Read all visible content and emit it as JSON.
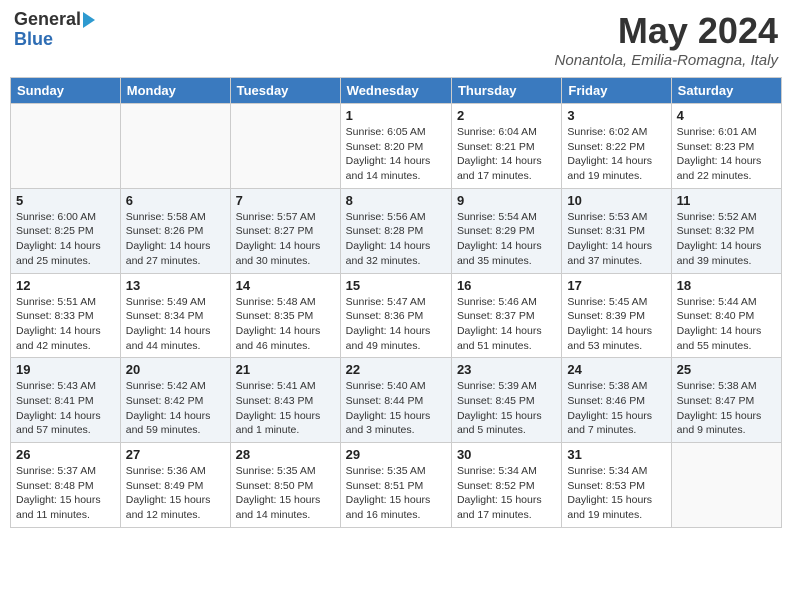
{
  "logo": {
    "general": "General",
    "blue": "Blue"
  },
  "title": {
    "month_year": "May 2024",
    "location": "Nonantola, Emilia-Romagna, Italy"
  },
  "calendar": {
    "headers": [
      "Sunday",
      "Monday",
      "Tuesday",
      "Wednesday",
      "Thursday",
      "Friday",
      "Saturday"
    ],
    "weeks": [
      [
        {
          "day": "",
          "info": ""
        },
        {
          "day": "",
          "info": ""
        },
        {
          "day": "",
          "info": ""
        },
        {
          "day": "1",
          "info": "Sunrise: 6:05 AM\nSunset: 8:20 PM\nDaylight: 14 hours and 14 minutes."
        },
        {
          "day": "2",
          "info": "Sunrise: 6:04 AM\nSunset: 8:21 PM\nDaylight: 14 hours and 17 minutes."
        },
        {
          "day": "3",
          "info": "Sunrise: 6:02 AM\nSunset: 8:22 PM\nDaylight: 14 hours and 19 minutes."
        },
        {
          "day": "4",
          "info": "Sunrise: 6:01 AM\nSunset: 8:23 PM\nDaylight: 14 hours and 22 minutes."
        }
      ],
      [
        {
          "day": "5",
          "info": "Sunrise: 6:00 AM\nSunset: 8:25 PM\nDaylight: 14 hours and 25 minutes."
        },
        {
          "day": "6",
          "info": "Sunrise: 5:58 AM\nSunset: 8:26 PM\nDaylight: 14 hours and 27 minutes."
        },
        {
          "day": "7",
          "info": "Sunrise: 5:57 AM\nSunset: 8:27 PM\nDaylight: 14 hours and 30 minutes."
        },
        {
          "day": "8",
          "info": "Sunrise: 5:56 AM\nSunset: 8:28 PM\nDaylight: 14 hours and 32 minutes."
        },
        {
          "day": "9",
          "info": "Sunrise: 5:54 AM\nSunset: 8:29 PM\nDaylight: 14 hours and 35 minutes."
        },
        {
          "day": "10",
          "info": "Sunrise: 5:53 AM\nSunset: 8:31 PM\nDaylight: 14 hours and 37 minutes."
        },
        {
          "day": "11",
          "info": "Sunrise: 5:52 AM\nSunset: 8:32 PM\nDaylight: 14 hours and 39 minutes."
        }
      ],
      [
        {
          "day": "12",
          "info": "Sunrise: 5:51 AM\nSunset: 8:33 PM\nDaylight: 14 hours and 42 minutes."
        },
        {
          "day": "13",
          "info": "Sunrise: 5:49 AM\nSunset: 8:34 PM\nDaylight: 14 hours and 44 minutes."
        },
        {
          "day": "14",
          "info": "Sunrise: 5:48 AM\nSunset: 8:35 PM\nDaylight: 14 hours and 46 minutes."
        },
        {
          "day": "15",
          "info": "Sunrise: 5:47 AM\nSunset: 8:36 PM\nDaylight: 14 hours and 49 minutes."
        },
        {
          "day": "16",
          "info": "Sunrise: 5:46 AM\nSunset: 8:37 PM\nDaylight: 14 hours and 51 minutes."
        },
        {
          "day": "17",
          "info": "Sunrise: 5:45 AM\nSunset: 8:39 PM\nDaylight: 14 hours and 53 minutes."
        },
        {
          "day": "18",
          "info": "Sunrise: 5:44 AM\nSunset: 8:40 PM\nDaylight: 14 hours and 55 minutes."
        }
      ],
      [
        {
          "day": "19",
          "info": "Sunrise: 5:43 AM\nSunset: 8:41 PM\nDaylight: 14 hours and 57 minutes."
        },
        {
          "day": "20",
          "info": "Sunrise: 5:42 AM\nSunset: 8:42 PM\nDaylight: 14 hours and 59 minutes."
        },
        {
          "day": "21",
          "info": "Sunrise: 5:41 AM\nSunset: 8:43 PM\nDaylight: 15 hours and 1 minute."
        },
        {
          "day": "22",
          "info": "Sunrise: 5:40 AM\nSunset: 8:44 PM\nDaylight: 15 hours and 3 minutes."
        },
        {
          "day": "23",
          "info": "Sunrise: 5:39 AM\nSunset: 8:45 PM\nDaylight: 15 hours and 5 minutes."
        },
        {
          "day": "24",
          "info": "Sunrise: 5:38 AM\nSunset: 8:46 PM\nDaylight: 15 hours and 7 minutes."
        },
        {
          "day": "25",
          "info": "Sunrise: 5:38 AM\nSunset: 8:47 PM\nDaylight: 15 hours and 9 minutes."
        }
      ],
      [
        {
          "day": "26",
          "info": "Sunrise: 5:37 AM\nSunset: 8:48 PM\nDaylight: 15 hours and 11 minutes."
        },
        {
          "day": "27",
          "info": "Sunrise: 5:36 AM\nSunset: 8:49 PM\nDaylight: 15 hours and 12 minutes."
        },
        {
          "day": "28",
          "info": "Sunrise: 5:35 AM\nSunset: 8:50 PM\nDaylight: 15 hours and 14 minutes."
        },
        {
          "day": "29",
          "info": "Sunrise: 5:35 AM\nSunset: 8:51 PM\nDaylight: 15 hours and 16 minutes."
        },
        {
          "day": "30",
          "info": "Sunrise: 5:34 AM\nSunset: 8:52 PM\nDaylight: 15 hours and 17 minutes."
        },
        {
          "day": "31",
          "info": "Sunrise: 5:34 AM\nSunset: 8:53 PM\nDaylight: 15 hours and 19 minutes."
        },
        {
          "day": "",
          "info": ""
        }
      ]
    ]
  }
}
